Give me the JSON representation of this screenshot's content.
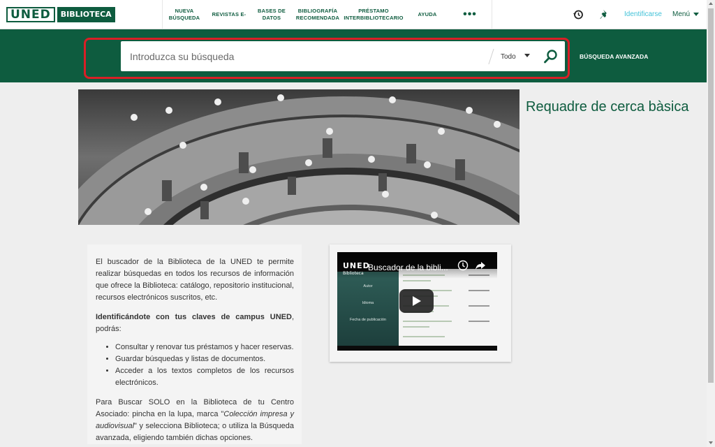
{
  "header": {
    "logo_primary": "UNED",
    "logo_secondary": "BIBLIOTECA",
    "nav": [
      {
        "line1": "NUEVA",
        "line2": "BÚSQUEDA"
      },
      {
        "line1": "REVISTAS E-",
        "line2": ""
      },
      {
        "line1": "BASES DE",
        "line2": "DATOS"
      },
      {
        "line1": "BIBLIOGRAFÍA",
        "line2": "RECOMENDADA"
      },
      {
        "line1": "PRÉSTAMO",
        "line2": "INTERBIBLIOTECARIO"
      },
      {
        "line1": "AYUDA",
        "line2": ""
      }
    ],
    "more": "•••",
    "icons": [
      "history-icon",
      "pin-icon"
    ],
    "signin_label": "Identificarse",
    "menu_label": "Menú"
  },
  "search": {
    "placeholder": "Introduzca su búsqueda",
    "scope_label": "Todo",
    "advanced_label": "BÚSQUEDA AVANZADA",
    "highlight_color": "#d91f26"
  },
  "main": {
    "side_title": "Requadre de cerca bàsica"
  },
  "info": {
    "p1": "El buscador de la Biblioteca de la UNED te permite realizar búsquedas en todos los recursos de información que ofrece la Biblioteca: catálogo, repositorio institucional, recursos electrónicos suscritos, etc.",
    "p2_bold": "Identificándote con tus claves de campus UNED",
    "p2_rest": ", podrás:",
    "bullets": [
      "Consultar y renovar tus préstamos y hacer reservas.",
      "Guardar búsquedas y listas de documentos.",
      "Acceder a los textos completos de los recursos electrónicos."
    ],
    "p3_a": "Para Buscar SOLO en la Biblioteca de tu Centro Asociado: pincha en la lupa, marca \"",
    "p3_italic": "Colección impresa y audiovisual",
    "p3_b": "\" y selecciona Biblioteca; o utiliza la Búsqueda avanzada, eligiendo también dichas opciones."
  },
  "video": {
    "logo": "UNED",
    "logo_sub": "Biblioteca",
    "title": "Buscador de la bibli...",
    "side_items": [
      "Autor",
      "Idioma",
      "Fecha de publicación"
    ]
  },
  "colors": {
    "brand_green": "#0e5c3f",
    "link_cyan": "#42c2d8",
    "page_bg": "#eeeeee"
  }
}
